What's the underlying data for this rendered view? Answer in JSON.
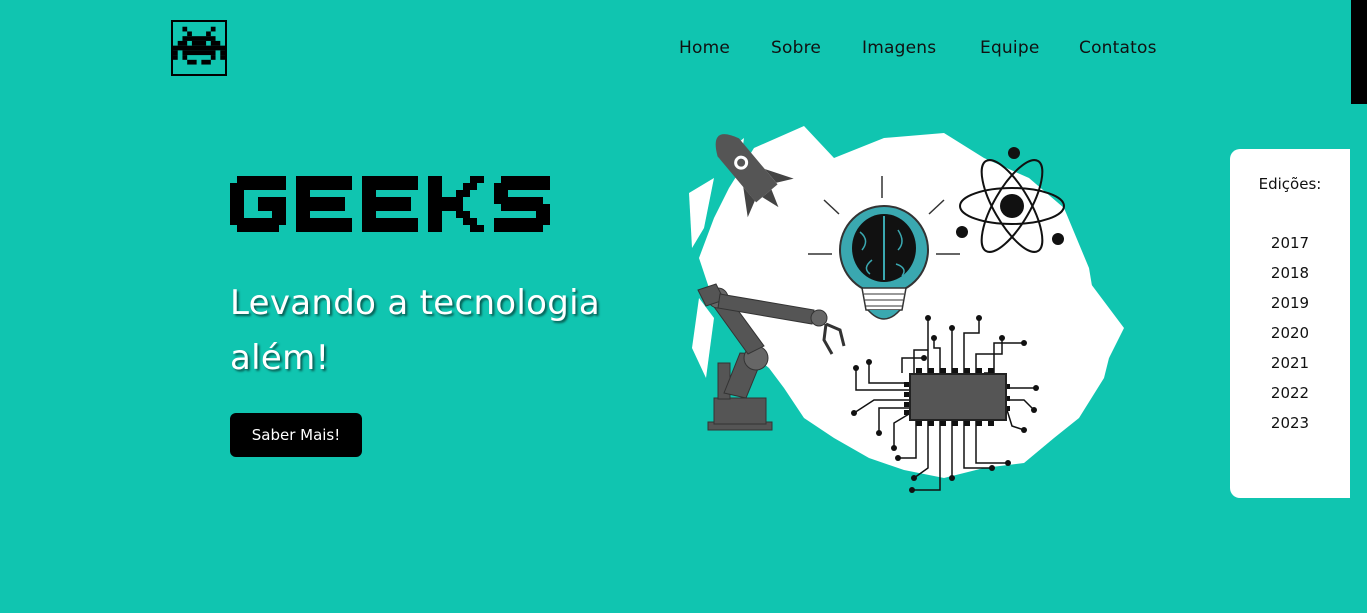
{
  "header": {
    "logo_icon": "space-invader-icon",
    "nav": [
      "Home",
      "Sobre",
      "Imagens",
      "Equipe",
      "Contatos"
    ]
  },
  "hero": {
    "title": "GEEKS",
    "tagline": "Levando a tecnologia além!",
    "cta_label": "Saber Mais!",
    "illustration_icons": [
      "rocket-icon",
      "lightbulb-brain-icon",
      "atom-icon",
      "robotic-arm-icon",
      "microchip-icon"
    ]
  },
  "editions": {
    "title": "Edições:",
    "years": [
      "2017",
      "2018",
      "2019",
      "2020",
      "2021",
      "2022",
      "2023"
    ]
  },
  "colors": {
    "background": "#10c5b0",
    "button": "#000000",
    "panel": "#ffffff"
  }
}
